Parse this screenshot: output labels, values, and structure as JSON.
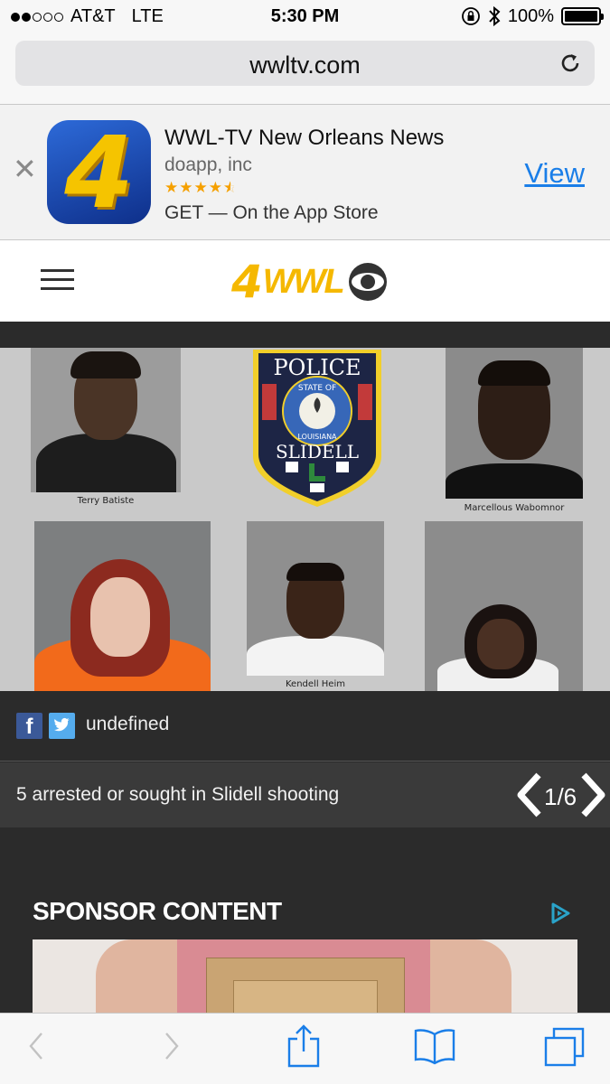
{
  "status_bar": {
    "carrier": "AT&T",
    "network": "LTE",
    "time": "5:30 PM",
    "battery": "100%",
    "signal_bars": 2,
    "signal_total": 5
  },
  "browser": {
    "url": "wwltv.com"
  },
  "app_banner": {
    "app_name": "WWL-TV New Orleans News",
    "developer": "doapp, inc",
    "rating_stars": 4.5,
    "get_text": "GET — On the App Store",
    "view_label": "View"
  },
  "site": {
    "logo_number": "4",
    "logo_text": "WWL"
  },
  "slideshow": {
    "photo_labels": {
      "top_left": "Terry Batiste",
      "top_right": "Marcellous Wabomnor",
      "bottom_middle": "Kendell Heim"
    },
    "patch": {
      "top": "POLICE",
      "state": "STATE OF",
      "louisiana": "LOUISIANA",
      "city": "SLIDELL"
    },
    "share_text": "undefined",
    "caption": "5 arrested or sought in Slidell shooting",
    "counter": "1/6"
  },
  "sponsor": {
    "heading": "SPONSOR CONTENT"
  },
  "colors": {
    "logo_yellow": "#f5b800",
    "link_blue": "#1a7ee8",
    "facebook": "#3b5998",
    "twitter": "#55acee",
    "dark_bg": "#2b2b2b"
  }
}
